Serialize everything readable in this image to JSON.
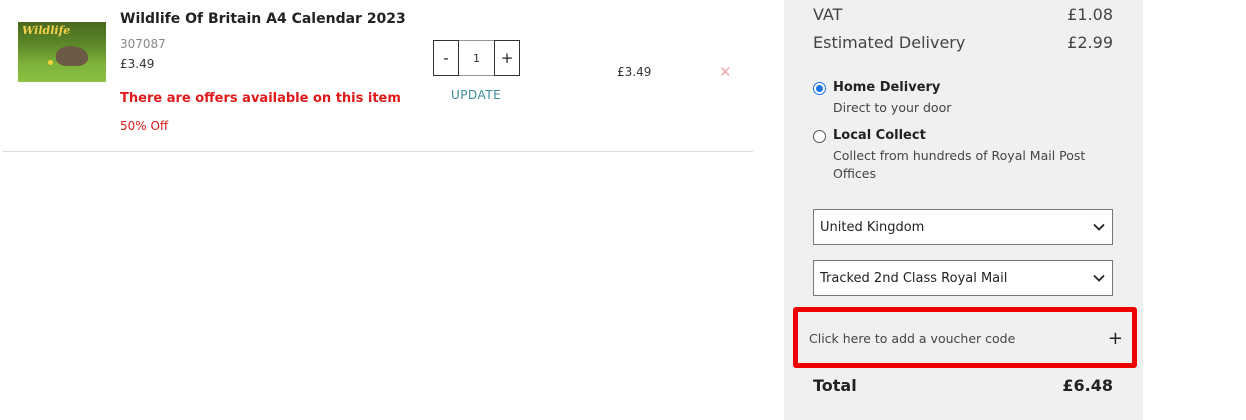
{
  "cart": {
    "item": {
      "title": "Wildlife Of Britain A4 Calendar 2023",
      "thumbnail_text": "Wildlife",
      "sku": "307087",
      "price": "£3.49",
      "offers_text": "There are offers available on this item",
      "discount": "50% Off",
      "quantity": "1",
      "qty_minus": "-",
      "qty_plus": "+",
      "update_label": "UPDATE",
      "line_total": "£3.49",
      "remove_glyph": "✕"
    }
  },
  "summary": {
    "vat_label": "VAT",
    "vat_value": "£1.08",
    "delivery_label": "Estimated Delivery",
    "delivery_value": "£2.99",
    "options": {
      "home": {
        "label": "Home Delivery",
        "sub": "Direct to your door",
        "selected": true
      },
      "local": {
        "label": "Local Collect",
        "sub": "Collect from hundreds of Royal Mail Post Offices",
        "selected": false
      }
    },
    "country_select": "United Kingdom",
    "shipping_select": "Tracked 2nd Class Royal Mail",
    "voucher_label": "Click here to add a voucher code",
    "voucher_icon": "+",
    "total_label": "Total",
    "total_value": "£6.48"
  },
  "colors": {
    "offer_red": "#e01a1a",
    "highlight_border": "#ee0000",
    "link_teal": "#3a8b9a",
    "radio_blue": "#1a73e8",
    "panel_bg": "#f0f0f0"
  }
}
